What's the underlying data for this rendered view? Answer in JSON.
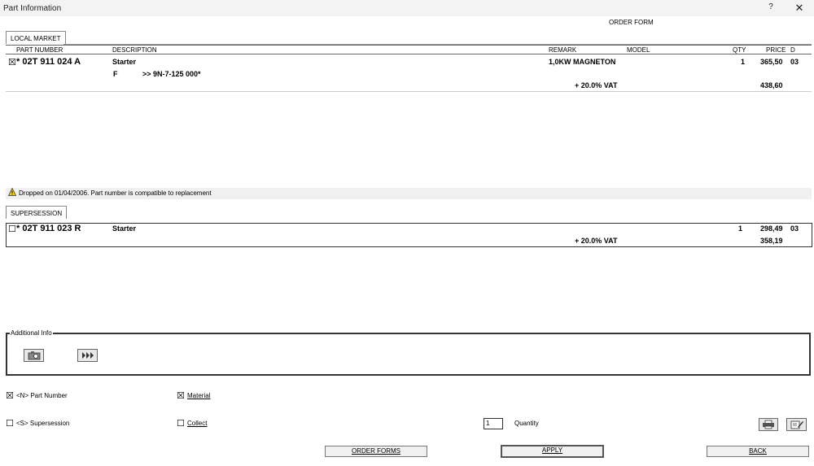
{
  "window": {
    "title": "Part Information",
    "help": "?",
    "close": "✕"
  },
  "form_title": "ORDER FORM",
  "local_market": {
    "tab": "LOCAL MARKET",
    "headers": {
      "part_number": "PART NUMBER",
      "description": "DESCRIPTION",
      "remark": "REMARK",
      "model": "MODEL",
      "qty": "QTY",
      "price": "PRICE",
      "d": "D"
    },
    "row": {
      "checkbox": "☒",
      "part_number": "* 02T 911 024 A",
      "description": "Starter",
      "remark": "1,0KW MAGNETON",
      "qty": "1",
      "price": "365,50",
      "d": "03",
      "sub_code": "F",
      "sub_text": ">> 9N-7-125 000*",
      "vat_label": "+ 20.0% VAT",
      "vat_price": "438,60"
    }
  },
  "warning": {
    "icon": "warning-icon",
    "text": "Dropped on 01/04/2006. Part number is compatible to replacement"
  },
  "supersession": {
    "tab": "SUPERSESSION",
    "row": {
      "checkbox": "☐",
      "part_number": "* 02T 911 023 R",
      "description": "Starter",
      "qty": "1",
      "price": "298,49",
      "d": "03",
      "vat_label": "+ 20.0% VAT",
      "vat_price": "358,19"
    }
  },
  "additional_info": {
    "legend": "Additional Info",
    "camera_icon": "camera-icon",
    "forward_icon": "fast-forward-icon"
  },
  "options": {
    "part_number": {
      "checked": "☒",
      "label": "<N> Part Number"
    },
    "material": {
      "checked": "☒",
      "label": "Material"
    },
    "supersession": {
      "checked": "☐",
      "label": "<S> Supersession"
    },
    "collect": {
      "checked": "☐",
      "label": "Collect"
    }
  },
  "quantity": {
    "value": "1",
    "label": "Quantity"
  },
  "buttons": {
    "order_forms": "ORDER FORMS",
    "apply": "APPLY",
    "back": "BACK"
  },
  "icons": {
    "print": "print-icon",
    "edit": "edit-icon"
  }
}
